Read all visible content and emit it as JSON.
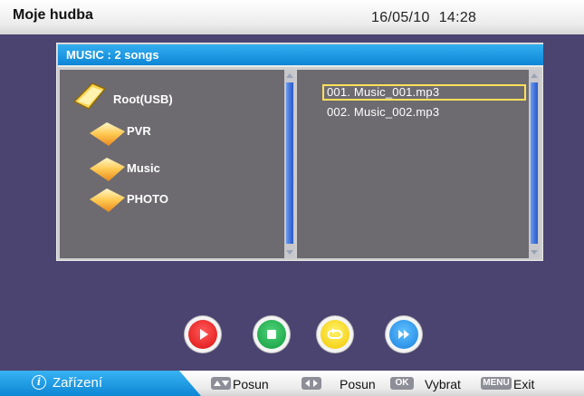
{
  "header": {
    "title": "Moje hudba",
    "date": "16/05/10",
    "time": "14:28"
  },
  "browser": {
    "title": "MUSIC : 2 songs",
    "folders": [
      {
        "label": "Root(USB)",
        "icon": "open-folder-icon"
      },
      {
        "label": "PVR",
        "icon": "folder-icon"
      },
      {
        "label": "Music",
        "icon": "folder-icon"
      },
      {
        "label": "PHOTO",
        "icon": "folder-icon"
      }
    ],
    "files": [
      {
        "label": "001.  Music_001.mp3",
        "selected": true
      },
      {
        "label": "002.  Music_002.mp3",
        "selected": false
      }
    ]
  },
  "controls": [
    {
      "name": "play",
      "icon": "play-icon",
      "color": "#dd1010"
    },
    {
      "name": "stop",
      "icon": "stop-icon",
      "color": "#129c3d"
    },
    {
      "name": "repeat",
      "icon": "repeat-icon",
      "color": "#f2c800"
    },
    {
      "name": "fast-forward",
      "icon": "fast-forward-icon",
      "color": "#1a82e0"
    }
  ],
  "footer": {
    "device_label": "Zařízení",
    "hint_move_vertical": "Posun",
    "hint_move_horizontal": "Posun",
    "ok_key": "OK",
    "hint_select": "Vybrat",
    "menu_key": "MENU",
    "hint_exit": "Exit"
  },
  "colors": {
    "accent_blue": "#0c86d6",
    "selection": "#ffe05a",
    "background": "#4b4470"
  }
}
